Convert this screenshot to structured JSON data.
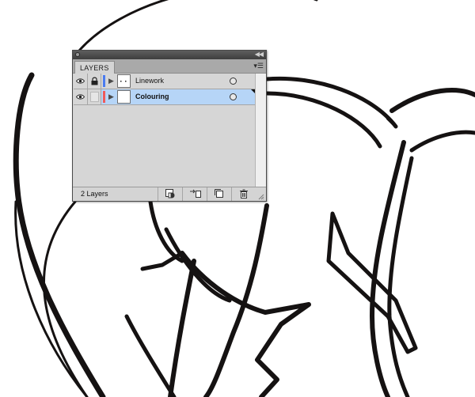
{
  "panel": {
    "tab_label": "LAYERS",
    "footer_count": "2 Layers",
    "menu_icon": "panel-menu-icon",
    "collapse_icon": "collapse-arrows-icon"
  },
  "layers": [
    {
      "name": "Linework",
      "visible": true,
      "locked": true,
      "color": "#4a7bf0",
      "selected": false
    },
    {
      "name": "Colouring",
      "visible": true,
      "locked": false,
      "color": "#f05a5a",
      "selected": true
    }
  ],
  "footer_buttons": [
    "make-clipping-mask-icon",
    "create-sublayer-icon",
    "create-new-layer-icon",
    "delete-layer-icon"
  ],
  "colors": {
    "selection": "#b6d5f7",
    "artwork": "#111111"
  }
}
